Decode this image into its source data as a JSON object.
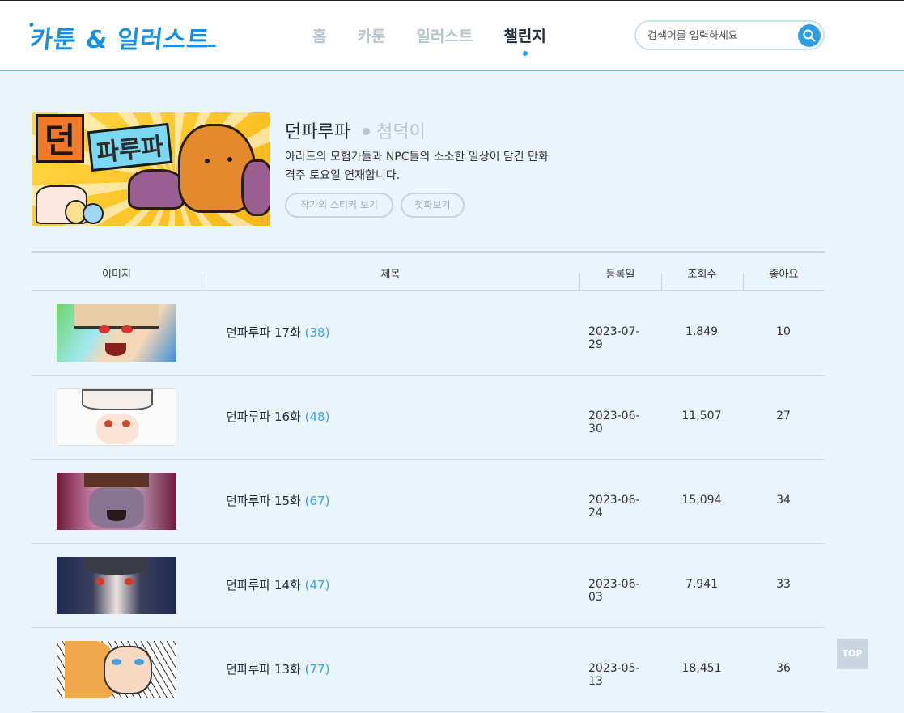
{
  "header": {
    "logo": "카툰 & 일러스트",
    "nav": [
      {
        "label": "홈",
        "active": false
      },
      {
        "label": "카툰",
        "active": false
      },
      {
        "label": "일러스트",
        "active": false
      },
      {
        "label": "챌린지",
        "active": true
      }
    ],
    "search_placeholder": "검색어를 입력하세요",
    "accent_color": "#2d9ee6"
  },
  "series": {
    "cover_text_1": "던",
    "cover_text_2": "파루파",
    "title": "던파루파",
    "author": "첨덕이",
    "description_line1": "아라드의 모험가들과 NPC들의 소소한 일상이 담긴 만화",
    "description_line2": "격주 토요일 연재합니다.",
    "buttons": {
      "stickers": "작가의 스티커 보기",
      "first_episode": "첫화보기"
    }
  },
  "table": {
    "headers": {
      "image": "이미지",
      "title": "제목",
      "date": "등록일",
      "views": "조회수",
      "likes": "좋아요"
    },
    "rows": [
      {
        "title": "던파루파 17화",
        "comments": "(38)",
        "date": "2023-07-29",
        "views": "1,849",
        "likes": "10"
      },
      {
        "title": "던파루파 16화",
        "comments": "(48)",
        "date": "2023-06-30",
        "views": "11,507",
        "likes": "27"
      },
      {
        "title": "던파루파 15화",
        "comments": "(67)",
        "date": "2023-06-24",
        "views": "15,094",
        "likes": "34"
      },
      {
        "title": "던파루파 14화",
        "comments": "(47)",
        "date": "2023-06-03",
        "views": "7,941",
        "likes": "33"
      },
      {
        "title": "던파루파 13화",
        "comments": "(77)",
        "date": "2023-05-13",
        "views": "18,451",
        "likes": "36"
      }
    ]
  },
  "top_button": "TOP"
}
